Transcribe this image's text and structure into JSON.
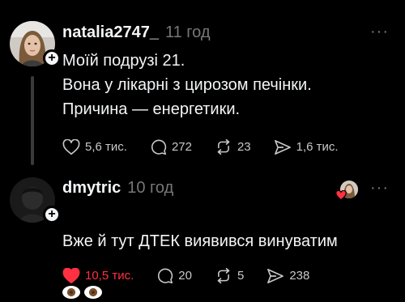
{
  "posts": [
    {
      "username": "natalia2747_",
      "time": "11 год",
      "text": "Моїй подрузі 21.\nВона у лікарні з цирозом печінки.\nПричина — енергетики.",
      "follow_symbol": "+",
      "more": "···",
      "likes": "5,6 тис.",
      "comments": "272",
      "reposts": "23",
      "shares": "1,6 тис.",
      "liked": false
    },
    {
      "username": "dmytric",
      "time": "10 год",
      "text": "Вже й тут ДТЕК виявився винуватим",
      "emoji": "eyes-emoji x2",
      "follow_symbol": "+",
      "more": "···",
      "likes": "10,5 тис.",
      "comments": "20",
      "reposts": "5",
      "shares": "238",
      "liked": true,
      "liked_by_author": true
    }
  ],
  "colors": {
    "background": "#000000",
    "text": "#f3f5f7",
    "muted": "#777777",
    "like_red": "#ff3040"
  },
  "icons": [
    "heart-icon",
    "comment-icon",
    "repost-icon",
    "share-icon",
    "more-icon",
    "plus-icon"
  ]
}
